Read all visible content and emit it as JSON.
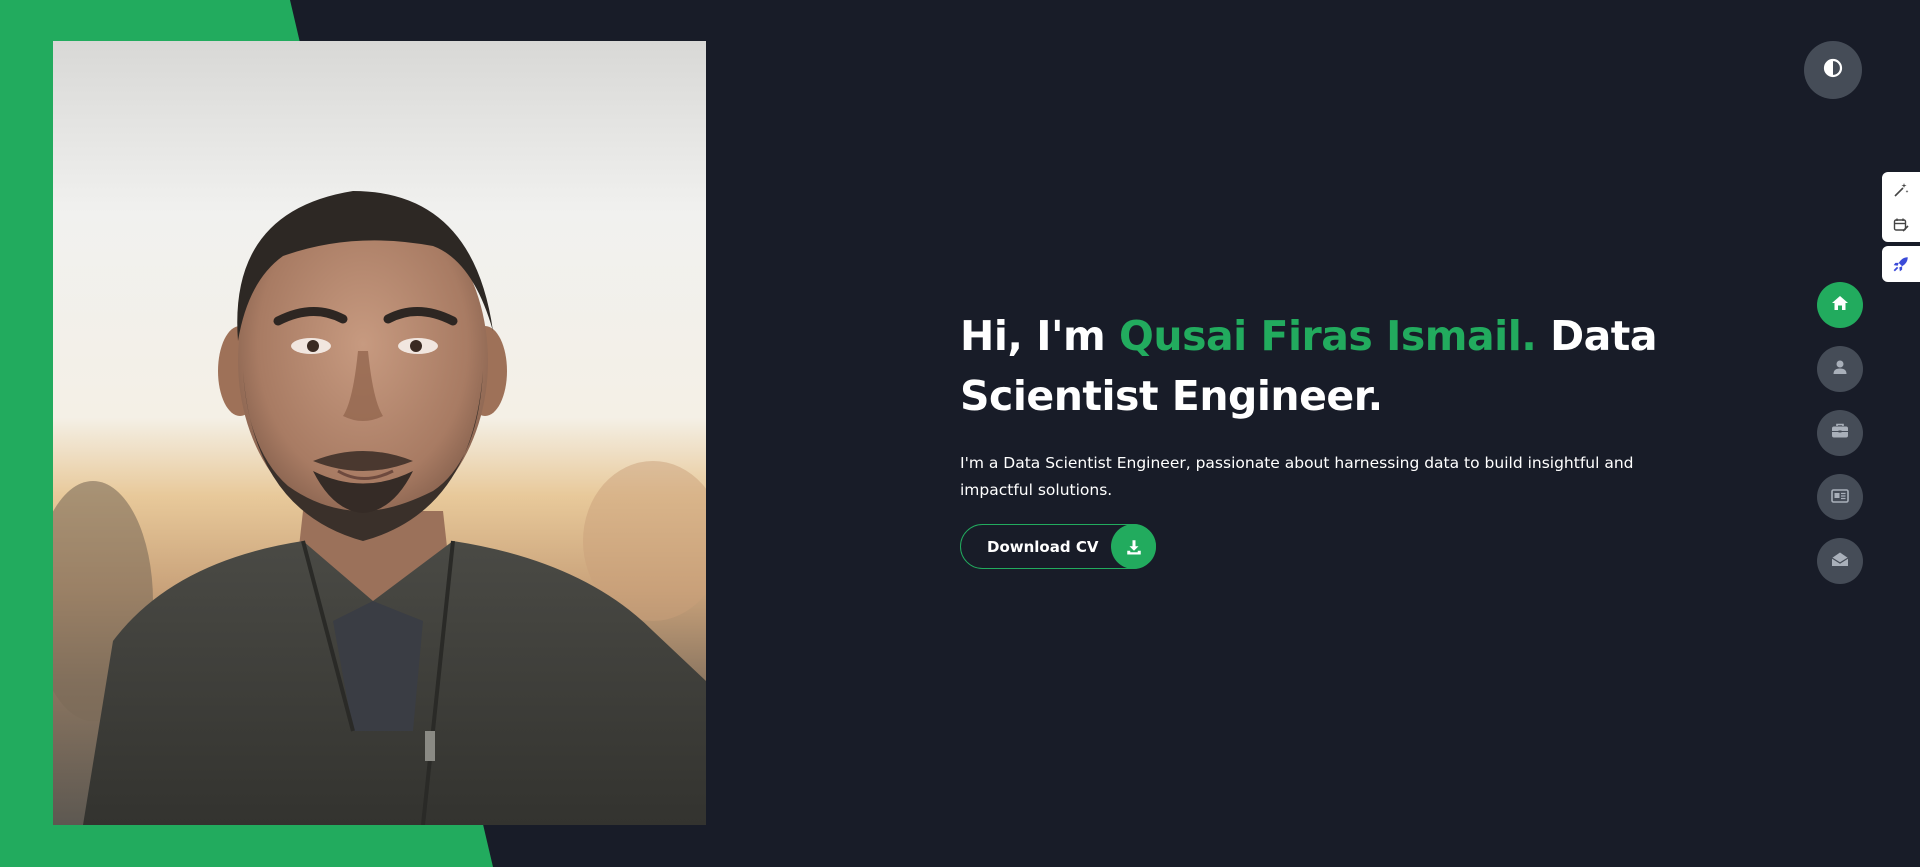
{
  "hero": {
    "greeting": "Hi, I'm",
    "name": "Qusai Firas Ismail.",
    "role": "Data Scientist Engineer.",
    "description": "I'm a Data Scientist Engineer, passionate about harnessing data to build insightful and impactful solutions.",
    "cv_button_label": "Download CV"
  },
  "colors": {
    "accent": "#22ab5e",
    "background": "#181c28",
    "nav_dot": "#454c57"
  },
  "icons": {
    "theme_toggle": "half-circle-contrast-icon",
    "download": "download-icon",
    "nav": [
      "home-icon",
      "user-icon",
      "briefcase-icon",
      "newspaper-icon",
      "envelope-open-icon"
    ],
    "tools": [
      "magic-wand-icon",
      "calendar-edit-icon",
      "rocket-icon"
    ]
  }
}
